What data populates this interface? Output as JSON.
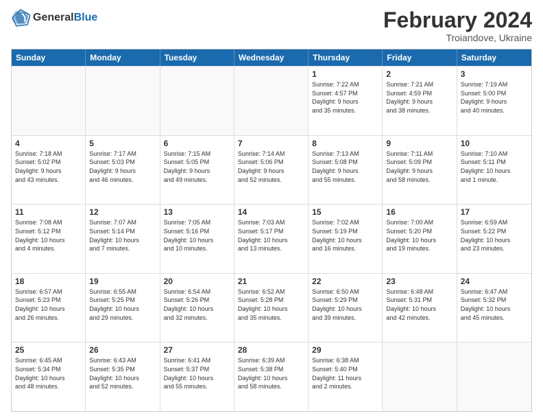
{
  "header": {
    "logo_line1": "General",
    "logo_line2": "Blue",
    "title": "February 2024",
    "subtitle": "Troiandove, Ukraine"
  },
  "days": [
    "Sunday",
    "Monday",
    "Tuesday",
    "Wednesday",
    "Thursday",
    "Friday",
    "Saturday"
  ],
  "rows": [
    [
      {
        "day": "",
        "info": ""
      },
      {
        "day": "",
        "info": ""
      },
      {
        "day": "",
        "info": ""
      },
      {
        "day": "",
        "info": ""
      },
      {
        "day": "1",
        "info": "Sunrise: 7:22 AM\nSunset: 4:57 PM\nDaylight: 9 hours\nand 35 minutes."
      },
      {
        "day": "2",
        "info": "Sunrise: 7:21 AM\nSunset: 4:59 PM\nDaylight: 9 hours\nand 38 minutes."
      },
      {
        "day": "3",
        "info": "Sunrise: 7:19 AM\nSunset: 5:00 PM\nDaylight: 9 hours\nand 40 minutes."
      }
    ],
    [
      {
        "day": "4",
        "info": "Sunrise: 7:18 AM\nSunset: 5:02 PM\nDaylight: 9 hours\nand 43 minutes."
      },
      {
        "day": "5",
        "info": "Sunrise: 7:17 AM\nSunset: 5:03 PM\nDaylight: 9 hours\nand 46 minutes."
      },
      {
        "day": "6",
        "info": "Sunrise: 7:15 AM\nSunset: 5:05 PM\nDaylight: 9 hours\nand 49 minutes."
      },
      {
        "day": "7",
        "info": "Sunrise: 7:14 AM\nSunset: 5:06 PM\nDaylight: 9 hours\nand 52 minutes."
      },
      {
        "day": "8",
        "info": "Sunrise: 7:13 AM\nSunset: 5:08 PM\nDaylight: 9 hours\nand 55 minutes."
      },
      {
        "day": "9",
        "info": "Sunrise: 7:11 AM\nSunset: 5:09 PM\nDaylight: 9 hours\nand 58 minutes."
      },
      {
        "day": "10",
        "info": "Sunrise: 7:10 AM\nSunset: 5:11 PM\nDaylight: 10 hours\nand 1 minute."
      }
    ],
    [
      {
        "day": "11",
        "info": "Sunrise: 7:08 AM\nSunset: 5:12 PM\nDaylight: 10 hours\nand 4 minutes."
      },
      {
        "day": "12",
        "info": "Sunrise: 7:07 AM\nSunset: 5:14 PM\nDaylight: 10 hours\nand 7 minutes."
      },
      {
        "day": "13",
        "info": "Sunrise: 7:05 AM\nSunset: 5:16 PM\nDaylight: 10 hours\nand 10 minutes."
      },
      {
        "day": "14",
        "info": "Sunrise: 7:03 AM\nSunset: 5:17 PM\nDaylight: 10 hours\nand 13 minutes."
      },
      {
        "day": "15",
        "info": "Sunrise: 7:02 AM\nSunset: 5:19 PM\nDaylight: 10 hours\nand 16 minutes."
      },
      {
        "day": "16",
        "info": "Sunrise: 7:00 AM\nSunset: 5:20 PM\nDaylight: 10 hours\nand 19 minutes."
      },
      {
        "day": "17",
        "info": "Sunrise: 6:59 AM\nSunset: 5:22 PM\nDaylight: 10 hours\nand 23 minutes."
      }
    ],
    [
      {
        "day": "18",
        "info": "Sunrise: 6:57 AM\nSunset: 5:23 PM\nDaylight: 10 hours\nand 26 minutes."
      },
      {
        "day": "19",
        "info": "Sunrise: 6:55 AM\nSunset: 5:25 PM\nDaylight: 10 hours\nand 29 minutes."
      },
      {
        "day": "20",
        "info": "Sunrise: 6:54 AM\nSunset: 5:26 PM\nDaylight: 10 hours\nand 32 minutes."
      },
      {
        "day": "21",
        "info": "Sunrise: 6:52 AM\nSunset: 5:28 PM\nDaylight: 10 hours\nand 35 minutes."
      },
      {
        "day": "22",
        "info": "Sunrise: 6:50 AM\nSunset: 5:29 PM\nDaylight: 10 hours\nand 39 minutes."
      },
      {
        "day": "23",
        "info": "Sunrise: 6:48 AM\nSunset: 5:31 PM\nDaylight: 10 hours\nand 42 minutes."
      },
      {
        "day": "24",
        "info": "Sunrise: 6:47 AM\nSunset: 5:32 PM\nDaylight: 10 hours\nand 45 minutes."
      }
    ],
    [
      {
        "day": "25",
        "info": "Sunrise: 6:45 AM\nSunset: 5:34 PM\nDaylight: 10 hours\nand 48 minutes."
      },
      {
        "day": "26",
        "info": "Sunrise: 6:43 AM\nSunset: 5:35 PM\nDaylight: 10 hours\nand 52 minutes."
      },
      {
        "day": "27",
        "info": "Sunrise: 6:41 AM\nSunset: 5:37 PM\nDaylight: 10 hours\nand 55 minutes."
      },
      {
        "day": "28",
        "info": "Sunrise: 6:39 AM\nSunset: 5:38 PM\nDaylight: 10 hours\nand 58 minutes."
      },
      {
        "day": "29",
        "info": "Sunrise: 6:38 AM\nSunset: 5:40 PM\nDaylight: 11 hours\nand 2 minutes."
      },
      {
        "day": "",
        "info": ""
      },
      {
        "day": "",
        "info": ""
      }
    ]
  ]
}
